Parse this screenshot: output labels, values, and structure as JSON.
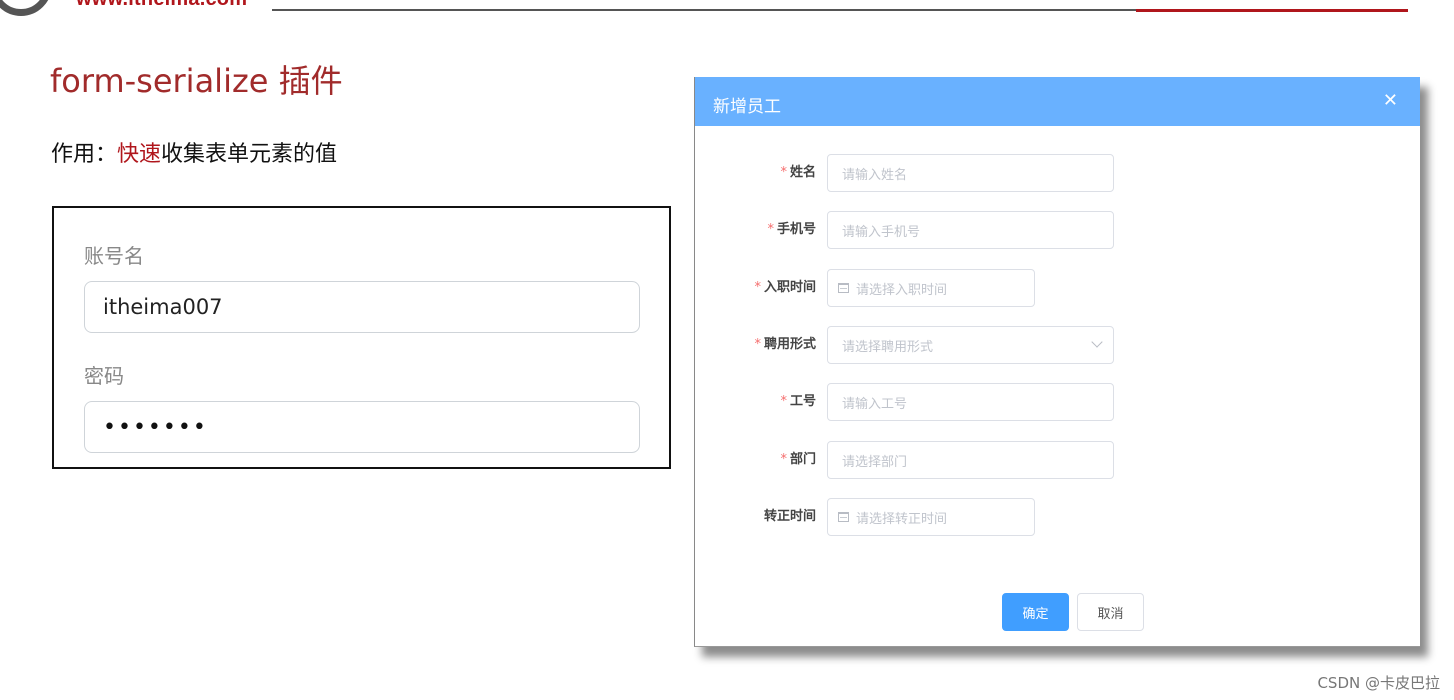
{
  "header": {
    "logo_url": "www.itheima.com",
    "colors": {
      "brand_red": "#b0161c",
      "line_gray": "#555555"
    }
  },
  "slide": {
    "title": "form-serialize 插件",
    "subtitle_prefix": "作用：",
    "subtitle_highlight": "快速",
    "subtitle_suffix": "收集表单元素的值"
  },
  "demo_form": {
    "username_label": "账号名",
    "username_value": "itheima007",
    "password_label": "密码",
    "password_masked": "•••••••"
  },
  "dialog": {
    "title": "新增员工",
    "close_icon": "close-icon",
    "header_color": "#69b1ff",
    "fields": [
      {
        "label": "姓名",
        "required": true,
        "placeholder": "请输入姓名",
        "type": "text"
      },
      {
        "label": "手机号",
        "required": true,
        "placeholder": "请输入手机号",
        "type": "text"
      },
      {
        "label": "入职时间",
        "required": true,
        "placeholder": "请选择入职时间",
        "type": "date"
      },
      {
        "label": "聘用形式",
        "required": true,
        "placeholder": "请选择聘用形式",
        "type": "select"
      },
      {
        "label": "工号",
        "required": true,
        "placeholder": "请输入工号",
        "type": "text"
      },
      {
        "label": "部门",
        "required": true,
        "placeholder": "请选择部门",
        "type": "text"
      },
      {
        "label": "转正时间",
        "required": false,
        "placeholder": "请选择转正时间",
        "type": "date"
      }
    ],
    "required_mark": "*",
    "confirm_label": "确定",
    "cancel_label": "取消",
    "primary_color": "#409eff"
  },
  "watermark": "CSDN @卡皮巴拉"
}
